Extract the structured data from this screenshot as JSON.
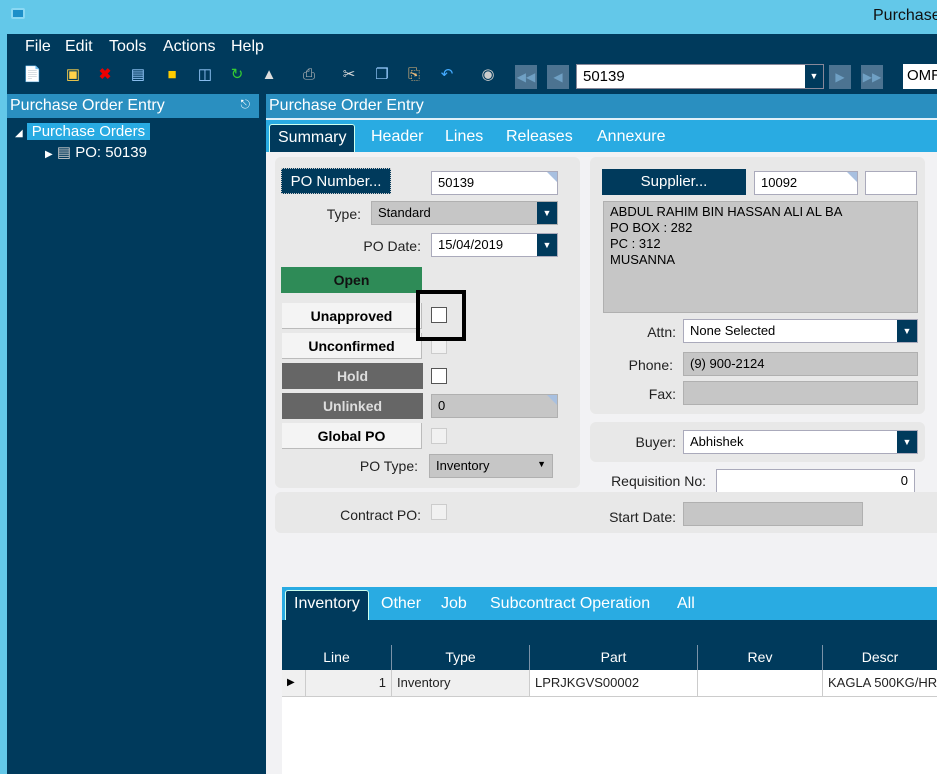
{
  "window": {
    "title": "Purchase",
    "app_icon": "app-icon"
  },
  "menu": [
    "File",
    "Edit",
    "Tools",
    "Actions",
    "Help"
  ],
  "toolbar": {
    "icons": [
      "new-document-icon",
      "save-icon",
      "delete-icon",
      "open-book-icon",
      "note-icon",
      "attach-icon",
      "refresh-icon",
      "eraser-icon",
      "print-icon",
      "cut-icon",
      "copy-icon",
      "paste-icon",
      "undo-icon",
      "binoculars-icon"
    ],
    "po_combo": "50139",
    "right_field": "OMR"
  },
  "left_panel": {
    "title": "Purchase Order Entry",
    "pin_icon": "pin-icon",
    "tree": {
      "root": "Purchase Orders",
      "child": "PO: 50139"
    }
  },
  "main": {
    "title": "Purchase Order Entry",
    "tabs": [
      "Summary",
      "Header",
      "Lines",
      "Releases",
      "Annexure"
    ],
    "active_tab": "Summary",
    "summary": {
      "po_number_button": "PO Number...",
      "po_number": "50139",
      "type_label": "Type:",
      "type_value": "Standard",
      "po_date_label": "PO Date:",
      "po_date": "15/04/2019",
      "status_open": "Open",
      "unapproved": "Unapproved",
      "unconfirmed": "Unconfirmed",
      "hold": "Hold",
      "unlinked": "Unlinked",
      "unlinked_value": "0",
      "global_po": "Global PO",
      "po_type_label": "PO Type:",
      "po_type": "Inventory",
      "supplier_button": "Supplier...",
      "supplier_id": "10092",
      "supplier_extra": "",
      "address": [
        "ABDUL RAHIM BIN HASSAN ALI AL BA",
        "PO BOX : 282",
        "PC : 312",
        "MUSANNA"
      ],
      "attn_label": "Attn:",
      "attn": "None Selected",
      "phone_label": "Phone:",
      "phone": "(9) 900-2124",
      "fax_label": "Fax:",
      "fax": "",
      "buyer_label": "Buyer:",
      "buyer": "Abhishek",
      "requisition_label": "Requisition No:",
      "requisition": "0",
      "contract_label": "Contract PO:",
      "start_date_label": "Start Date:",
      "start_date": "",
      "status_colors": {
        "open": "#2e8b57",
        "hold": "#666666"
      }
    },
    "line_tabs": [
      "Inventory",
      "Other",
      "Job",
      "Subcontract Operation",
      "All"
    ],
    "active_line_tab": "Inventory",
    "grid": {
      "columns": [
        "Line",
        "Type",
        "Part",
        "Rev",
        "Descr"
      ],
      "rows": [
        {
          "line": "1",
          "type": "Inventory",
          "part": "LPRJKGVS00002",
          "rev": "",
          "descr": "KAGLA 500KG/HR"
        }
      ]
    }
  }
}
